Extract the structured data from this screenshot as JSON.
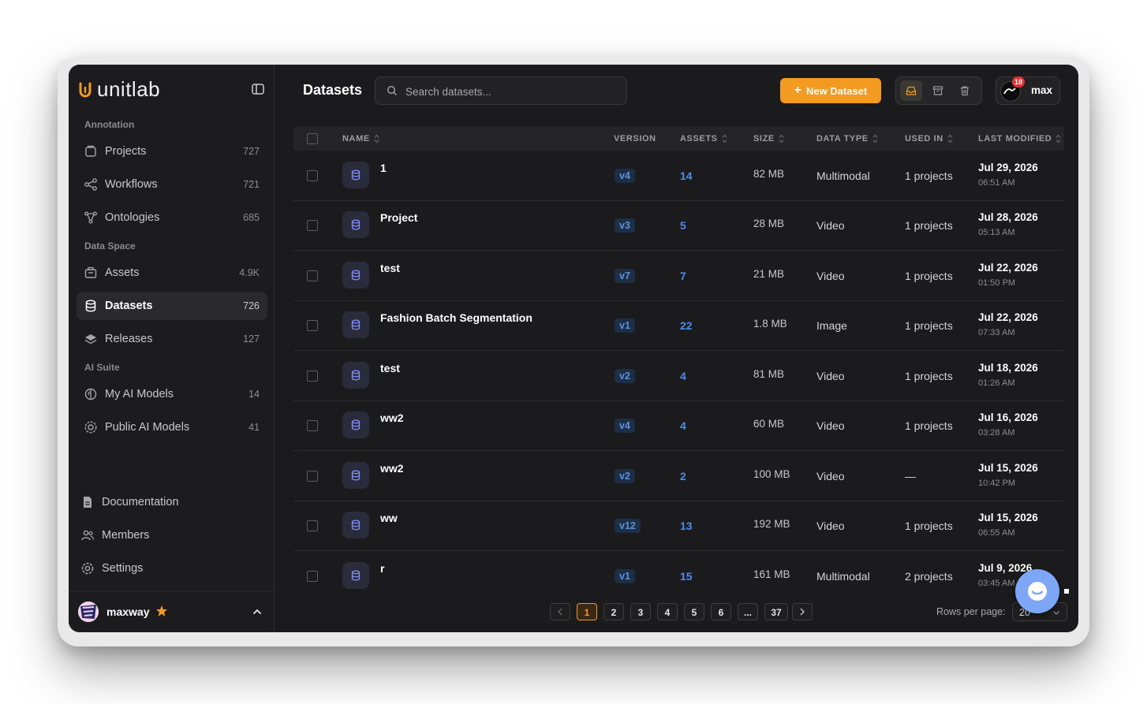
{
  "app": {
    "brand": "unitlab",
    "page_title": "Datasets"
  },
  "colors": {
    "accent": "#f39a20",
    "link": "#4b8df0",
    "background": "#1b1b1d"
  },
  "sidebar": {
    "sections": [
      {
        "label": "Annotation"
      },
      {
        "label": "Data Space"
      },
      {
        "label": "AI Suite"
      }
    ],
    "items": [
      {
        "label": "Projects",
        "count": "727",
        "icon": "folder-icon"
      },
      {
        "label": "Workflows",
        "count": "721",
        "icon": "workflow-icon"
      },
      {
        "label": "Ontologies",
        "count": "685",
        "icon": "ontology-icon"
      },
      {
        "label": "Assets",
        "count": "4.9K",
        "icon": "assets-icon"
      },
      {
        "label": "Datasets",
        "count": "726",
        "icon": "database-icon",
        "active": true
      },
      {
        "label": "Releases",
        "count": "127",
        "icon": "layers-icon"
      },
      {
        "label": "My AI Models",
        "count": "14",
        "icon": "brain-icon"
      },
      {
        "label": "Public AI Models",
        "count": "41",
        "icon": "globe-gear-icon"
      }
    ],
    "bottom": [
      {
        "label": "Documentation",
        "icon": "document-icon"
      },
      {
        "label": "Members",
        "icon": "members-icon"
      },
      {
        "label": "Settings",
        "icon": "settings-icon"
      }
    ],
    "user": {
      "name": "maxway"
    }
  },
  "header": {
    "search_placeholder": "Search datasets...",
    "new_button": "New Dataset",
    "profile_name": "max",
    "notification_count": "18"
  },
  "table": {
    "columns": [
      "NAME",
      "VERSION",
      "ASSETS",
      "SIZE",
      "DATA TYPE",
      "USED IN",
      "LAST MODIFIED"
    ],
    "rows": [
      {
        "name": "1",
        "version": "v4",
        "assets": "14",
        "size": "82 MB",
        "data_type": "Multimodal",
        "used_in": "1 projects",
        "date": "Jul 29, 2026",
        "time": "06:51 AM"
      },
      {
        "name": "Project",
        "version": "v3",
        "assets": "5",
        "size": "28 MB",
        "data_type": "Video",
        "used_in": "1 projects",
        "date": "Jul 28, 2026",
        "time": "05:13 AM"
      },
      {
        "name": "test",
        "version": "v7",
        "assets": "7",
        "size": "21 MB",
        "data_type": "Video",
        "used_in": "1 projects",
        "date": "Jul 22, 2026",
        "time": "01:50 PM"
      },
      {
        "name": "Fashion Batch Segmentation",
        "version": "v1",
        "assets": "22",
        "size": "1.8 MB",
        "data_type": "Image",
        "used_in": "1 projects",
        "date": "Jul 22, 2026",
        "time": "07:33 AM"
      },
      {
        "name": "test",
        "version": "v2",
        "assets": "4",
        "size": "81 MB",
        "data_type": "Video",
        "used_in": "1 projects",
        "date": "Jul 18, 2026",
        "time": "01:26 AM"
      },
      {
        "name": "ww2",
        "version": "v4",
        "assets": "4",
        "size": "60 MB",
        "data_type": "Video",
        "used_in": "1 projects",
        "date": "Jul 16, 2026",
        "time": "03:28 AM"
      },
      {
        "name": "ww2",
        "version": "v2",
        "assets": "2",
        "size": "100 MB",
        "data_type": "Video",
        "used_in": "—",
        "date": "Jul 15, 2026",
        "time": "10:42 PM"
      },
      {
        "name": "ww",
        "version": "v12",
        "assets": "13",
        "size": "192 MB",
        "data_type": "Video",
        "used_in": "1 projects",
        "date": "Jul 15, 2026",
        "time": "06:55 AM"
      },
      {
        "name": "r",
        "version": "v1",
        "assets": "15",
        "size": "161 MB",
        "data_type": "Multimodal",
        "used_in": "2 projects",
        "date": "Jul 9, 2026",
        "time": "03:45 AM"
      }
    ]
  },
  "pagination": {
    "pages": [
      "1",
      "2",
      "3",
      "4",
      "5",
      "6",
      "...",
      "37"
    ],
    "current": "1",
    "rows_per_page_label": "Rows per page:",
    "rows_per_page": "20"
  }
}
